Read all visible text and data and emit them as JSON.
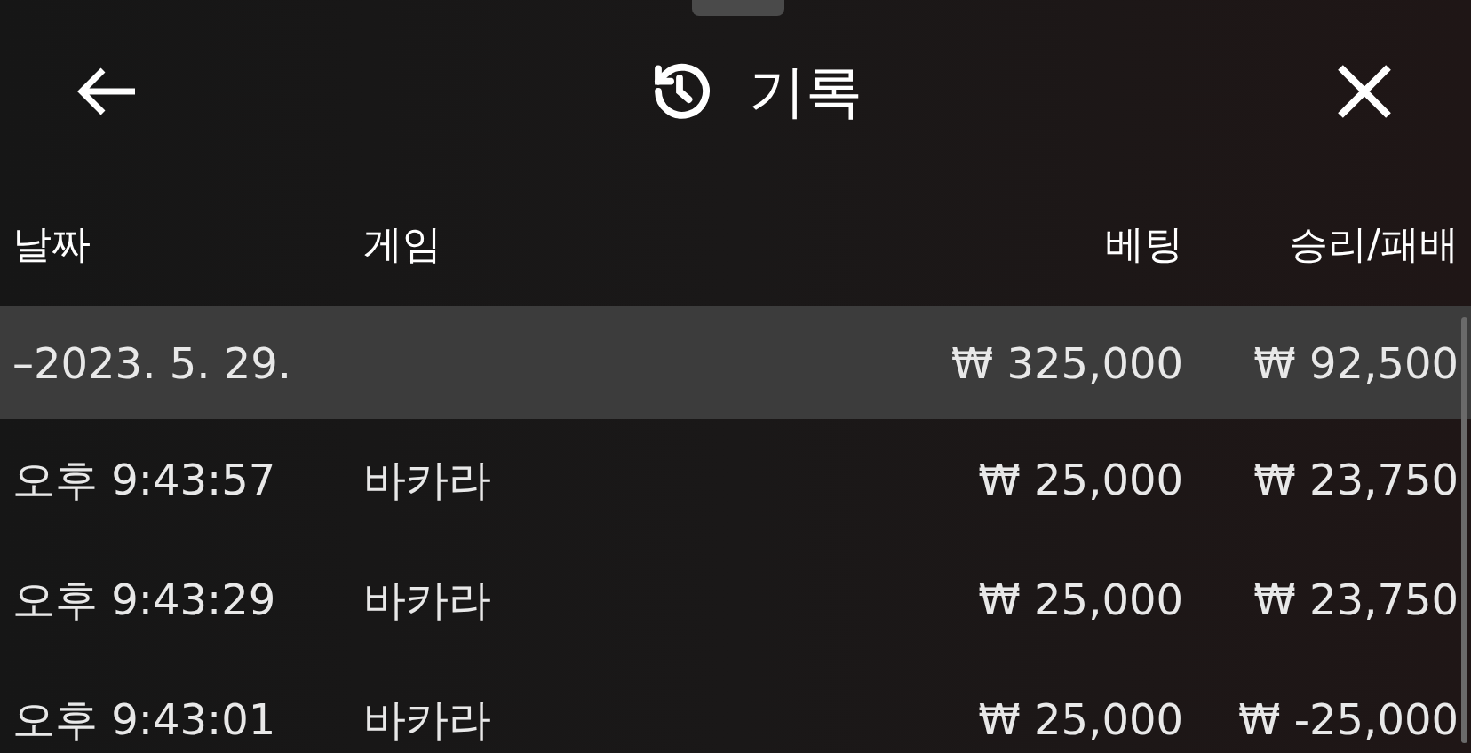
{
  "header": {
    "title": "기록"
  },
  "table": {
    "columns": [
      "날짜",
      "게임",
      "베팅",
      "승리/패배"
    ],
    "rows": [
      {
        "kind": "date",
        "selected": true,
        "cells": [
          "–2023. 5. 29.",
          "",
          "₩ 325,000",
          "₩ 92,500"
        ]
      },
      {
        "kind": "entry",
        "selected": false,
        "cells": [
          "오후 9:43:57",
          "바카라",
          "₩ 25,000",
          "₩ 23,750"
        ]
      },
      {
        "kind": "entry",
        "selected": false,
        "cells": [
          "오후 9:43:29",
          "바카라",
          "₩ 25,000",
          "₩ 23,750"
        ]
      },
      {
        "kind": "entry",
        "selected": false,
        "cells": [
          "오후 9:43:01",
          "바카라",
          "₩ 25,000",
          "₩ -25,000"
        ]
      }
    ]
  }
}
